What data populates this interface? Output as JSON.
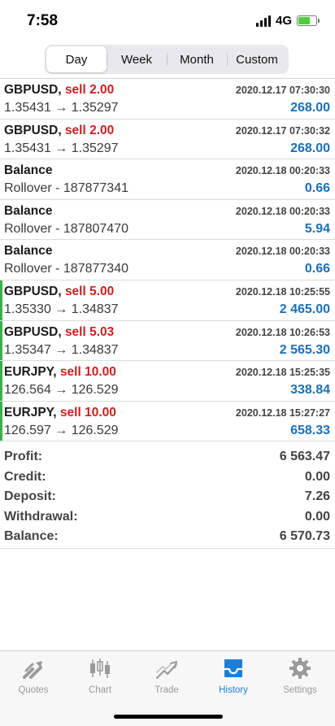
{
  "status": {
    "time": "7:58",
    "network": "4G"
  },
  "segments": [
    "Day",
    "Week",
    "Month",
    "Custom"
  ],
  "active_segment": "Day",
  "rows": [
    {
      "symbol": "GBPUSD,",
      "action": "sell 2.00",
      "date": "2020.12.17 07:30:30",
      "detail": "1.35431 → 1.35297",
      "amount": "268.00"
    },
    {
      "symbol": "GBPUSD,",
      "action": "sell 2.00",
      "date": "2020.12.17 07:30:32",
      "detail": "1.35431 → 1.35297",
      "amount": "268.00"
    },
    {
      "symbol": "Balance",
      "action": "",
      "date": "2020.12.18 00:20:33",
      "detail": "Rollover - 187877341",
      "amount": "0.66"
    },
    {
      "symbol": "Balance",
      "action": "",
      "date": "2020.12.18 00:20:33",
      "detail": "Rollover - 187807470",
      "amount": "5.94"
    },
    {
      "symbol": "Balance",
      "action": "",
      "date": "2020.12.18 00:20:33",
      "detail": "Rollover - 187877340",
      "amount": "0.66"
    },
    {
      "symbol": "GBPUSD,",
      "action": "sell 5.00",
      "date": "2020.12.18 10:25:55",
      "detail": "1.35330 → 1.34837",
      "amount": "2 465.00"
    },
    {
      "symbol": "GBPUSD,",
      "action": "sell 5.03",
      "date": "2020.12.18 10:26:53",
      "detail": "1.35347 → 1.34837",
      "amount": "2 565.30"
    },
    {
      "symbol": "EURJPY,",
      "action": "sell 10.00",
      "date": "2020.12.18 15:25:35",
      "detail": "126.564 → 126.529",
      "amount": "338.84"
    },
    {
      "symbol": "EURJPY,",
      "action": "sell 10.00",
      "date": "2020.12.18 15:27:27",
      "detail": "126.597 → 126.529",
      "amount": "658.33"
    }
  ],
  "summary": [
    {
      "label": "Profit:",
      "value": "6 563.47"
    },
    {
      "label": "Credit:",
      "value": "0.00"
    },
    {
      "label": "Deposit:",
      "value": "7.26"
    },
    {
      "label": "Withdrawal:",
      "value": "0.00"
    },
    {
      "label": "Balance:",
      "value": "6 570.73"
    }
  ],
  "tabs": [
    {
      "label": "Quotes",
      "icon": "quotes-icon"
    },
    {
      "label": "Chart",
      "icon": "chart-icon"
    },
    {
      "label": "Trade",
      "icon": "trade-icon"
    },
    {
      "label": "History",
      "icon": "history-icon"
    },
    {
      "label": "Settings",
      "icon": "gear-icon"
    }
  ],
  "active_tab": "History",
  "colors": {
    "sell": "#c8201f",
    "amount": "#1c6fb8",
    "profit_marker": "#35b34a",
    "tab_active": "#1c7ed6",
    "tab_inactive": "#9a9a9a"
  }
}
